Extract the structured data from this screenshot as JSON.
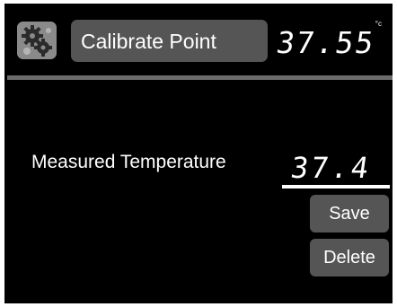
{
  "header": {
    "settings_icon": "gears-icon",
    "title": "Calibrate Point",
    "current_reading": "37.55",
    "unit": "°c"
  },
  "calibration": {
    "label": "Measured Temperature",
    "measured_value": "37.4"
  },
  "actions": {
    "save_label": "Save",
    "delete_label": "Delete"
  },
  "colors": {
    "background": "#000000",
    "panel": "#555555",
    "divider": "#6b6b6b",
    "text": "#ffffff",
    "icon_tile": "#8a8a8a"
  }
}
